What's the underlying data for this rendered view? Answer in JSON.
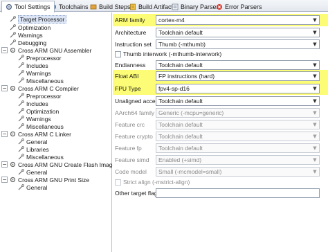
{
  "tabs": [
    {
      "label": "Tool Settings",
      "icon": "tool-settings-icon"
    },
    {
      "label": "Toolchains",
      "icon": "toolchains-icon"
    },
    {
      "label": "Build Steps",
      "icon": "build-steps-icon"
    },
    {
      "label": "Build Artifact",
      "icon": "build-artifact-icon"
    },
    {
      "label": "Binary Parsers",
      "icon": "binary-parsers-icon"
    },
    {
      "label": "Error Parsers",
      "icon": "error-parsers-icon"
    }
  ],
  "tree": {
    "items": [
      {
        "label": "Target Processor",
        "level": 1,
        "selected": true
      },
      {
        "label": "Optimization",
        "level": 1
      },
      {
        "label": "Warnings",
        "level": 1
      },
      {
        "label": "Debugging",
        "level": 1
      },
      {
        "label": "Cross ARM GNU Assembler",
        "level": 0,
        "expanded": true
      },
      {
        "label": "Preprocessor",
        "level": 1
      },
      {
        "label": "Includes",
        "level": 1
      },
      {
        "label": "Warnings",
        "level": 1
      },
      {
        "label": "Miscellaneous",
        "level": 1
      },
      {
        "label": "Cross ARM C Compiler",
        "level": 0,
        "expanded": true
      },
      {
        "label": "Preprocessor",
        "level": 1
      },
      {
        "label": "Includes",
        "level": 1
      },
      {
        "label": "Optimization",
        "level": 1
      },
      {
        "label": "Warnings",
        "level": 1
      },
      {
        "label": "Miscellaneous",
        "level": 1
      },
      {
        "label": "Cross ARM C Linker",
        "level": 0,
        "expanded": true
      },
      {
        "label": "General",
        "level": 1
      },
      {
        "label": "Libraries",
        "level": 1
      },
      {
        "label": "Miscellaneous",
        "level": 1
      },
      {
        "label": "Cross ARM GNU Create Flash Image",
        "level": 0,
        "expanded": true
      },
      {
        "label": "General",
        "level": 1
      },
      {
        "label": "Cross ARM GNU Print Size",
        "level": 0,
        "expanded": true
      },
      {
        "label": "General",
        "level": 1
      }
    ]
  },
  "settings": {
    "arm_family": {
      "label": "ARM family",
      "value": "cortex-m4"
    },
    "architecture": {
      "label": "Architecture",
      "value": "Toolchain default"
    },
    "instruction_set": {
      "label": "Instruction set",
      "value": "Thumb (-mthumb)"
    },
    "thumb_interwork": {
      "label": "Thumb interwork (-mthumb-interwork)"
    },
    "endianness": {
      "label": "Endianness",
      "value": "Toolchain default"
    },
    "float_abi": {
      "label": "Float ABI",
      "value": "FP instructions (hard)"
    },
    "fpu_type": {
      "label": "FPU Type",
      "value": "fpv4-sp-d16"
    },
    "unaligned_access": {
      "label": "Unaligned access",
      "value": "Toolchain default"
    },
    "aarch64_family": {
      "label": "AArch64 family",
      "value": "Generic (-mcpu=generic)"
    },
    "feature_crc": {
      "label": "Feature crc",
      "value": "Toolchain default"
    },
    "feature_crypto": {
      "label": "Feature crypto",
      "value": "Toolchain default"
    },
    "feature_fp": {
      "label": "Feature fp",
      "value": "Toolchain default"
    },
    "feature_simd": {
      "label": "Feature simd",
      "value": "Enabled (+simd)"
    },
    "code_model": {
      "label": "Code model",
      "value": "Small (-mcmodel=small)"
    },
    "strict_align": {
      "label": "Strict align (-mstrict-align)"
    },
    "other_target_flags": {
      "label": "Other target flags",
      "value": ""
    }
  },
  "colors": {
    "highlight": "#fcfc77",
    "selection": "#dbe5f5"
  }
}
